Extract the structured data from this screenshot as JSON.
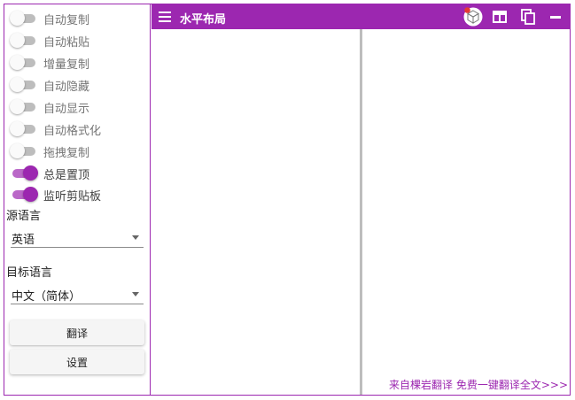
{
  "toggles": [
    {
      "label": "自动复制",
      "on": false
    },
    {
      "label": "自动粘贴",
      "on": false
    },
    {
      "label": "增量复制",
      "on": false
    },
    {
      "label": "自动隐藏",
      "on": false
    },
    {
      "label": "自动显示",
      "on": false
    },
    {
      "label": "自动格式化",
      "on": false
    },
    {
      "label": "拖拽复制",
      "on": false
    },
    {
      "label": "总是置顶",
      "on": true
    },
    {
      "label": "监听剪贴板",
      "on": true
    }
  ],
  "source_lang": {
    "label": "源语言",
    "value": "英语"
  },
  "target_lang": {
    "label": "目标语言",
    "value": "中文（简体）"
  },
  "buttons": {
    "translate": "翻译",
    "settings": "设置"
  },
  "appbar": {
    "title": "水平布局"
  },
  "footer": {
    "link": "来自棵岩翻译 免费一键翻译全文>>>"
  },
  "colors": {
    "accent": "#9c27b0",
    "accent_light": "#ba68c8",
    "badge": "#e53935"
  },
  "icons": [
    "menu-icon",
    "cube-icon",
    "layout-icon",
    "copy-icon",
    "minimize-icon"
  ]
}
